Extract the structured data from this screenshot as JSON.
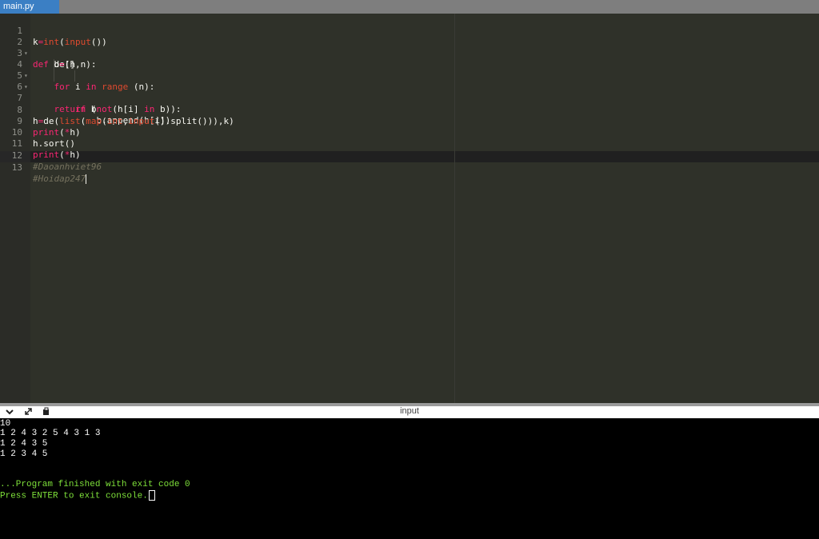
{
  "tab": {
    "filename": "main.py"
  },
  "editor": {
    "line_numbers": [
      "1",
      "2",
      "3",
      "4",
      "5",
      "6",
      "7",
      "8",
      "9",
      "10",
      "11",
      "12",
      "13"
    ],
    "lines": [
      "k=int(input())",
      "def de(h,n):",
      "b=[]",
      "for i in range (n):",
      "if (not(h[i] in b)):",
      "b.append(h[i])",
      "return b",
      "h=de(list(map(int,input().split())),k)",
      "print(*h)",
      "h.sort()",
      "print(*h)",
      "#Daoanhviet96",
      "#Hoidap247"
    ],
    "fold_marker": "▾"
  },
  "console_toolbar": {
    "title": "input",
    "icons": [
      "chevron-down-icon",
      "expand-icon",
      "copy-icon"
    ]
  },
  "console": {
    "lines": [
      "10",
      "1 2 4 3 2 5 4 3 1 3",
      "1 2 4 3 5",
      "1 2 3 4 5",
      "",
      "",
      "...Program finished with exit code 0",
      "Press ENTER to exit console."
    ]
  },
  "colors": {
    "tab_active": "#3b7fc4",
    "editor_bg": "#2f3129",
    "keyword": "#f92672",
    "builtin": "#e04a2f",
    "comment": "#75715e",
    "console_green": "#7ee03a"
  }
}
